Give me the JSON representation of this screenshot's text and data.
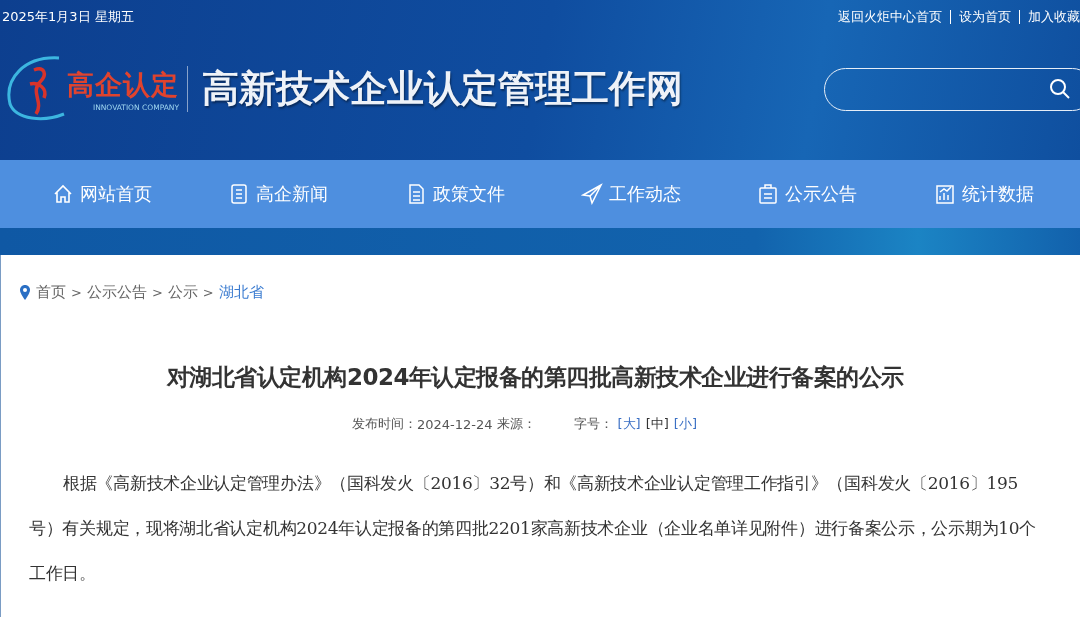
{
  "top_bar": {
    "date": "2025年1月3日 星期五",
    "links": [
      "返回火炬中心首页",
      "设为首页",
      "加入收藏"
    ]
  },
  "header": {
    "logo_text": "高企认定",
    "logo_subtext": "INNOVATION COMPANY",
    "site_title": "高新技术企业认定管理工作网"
  },
  "nav": [
    {
      "label": "网站首页",
      "kind": "home"
    },
    {
      "label": "高企新闻",
      "kind": "news"
    },
    {
      "label": "政策文件",
      "kind": "file"
    },
    {
      "label": "工作动态",
      "kind": "plane"
    },
    {
      "label": "公示公告",
      "kind": "board"
    },
    {
      "label": "统计数据",
      "kind": "chart"
    }
  ],
  "breadcrumb": [
    {
      "kind": "link",
      "label": "首页",
      "current": false
    },
    {
      "kind": "separator",
      "label": ">"
    },
    {
      "kind": "link",
      "label": "公示公告",
      "current": false
    },
    {
      "kind": "separator",
      "label": ">"
    },
    {
      "kind": "link",
      "label": "公示",
      "current": false
    },
    {
      "kind": "separator",
      "label": ">"
    },
    {
      "kind": "link",
      "label": "湖北省",
      "current": true
    }
  ],
  "article": {
    "title": "对湖北省认定机构2024年认定报备的第四批高新技术企业进行备案的公示",
    "published_label": "发布时间：",
    "published": "2024-12-24",
    "source_label": "来源：",
    "font_size_label": "字号：",
    "font_sizes": [
      {
        "label": "[大]",
        "selected": false
      },
      {
        "label": "[中]",
        "selected": true
      },
      {
        "label": "[小]",
        "selected": false
      }
    ],
    "body": "根据《高新技术企业认定管理办法》（国科发火〔2016〕32号）和《高新技术企业认定管理工作指引》（国科发火〔2016〕195号）有关规定，现将湖北省认定机构2024年认定报备的第四批2201家高新技术企业（企业名单详见附件）进行备案公示，公示期为10个工作日。"
  }
}
